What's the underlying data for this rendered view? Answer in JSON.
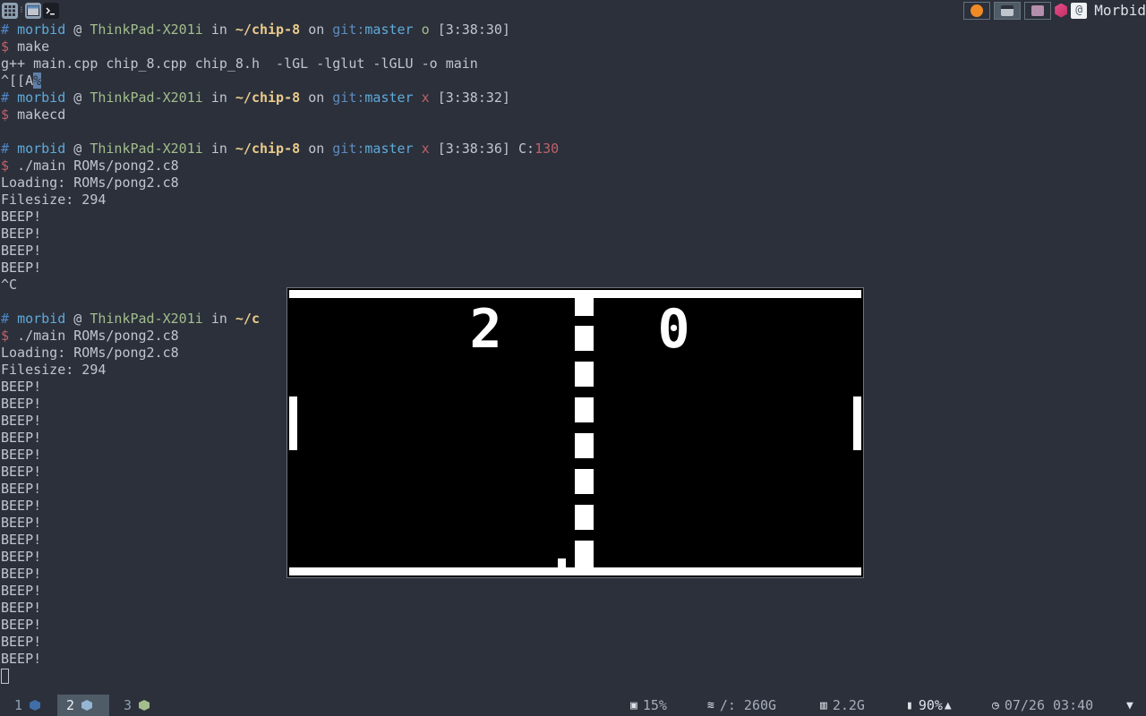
{
  "colors": {
    "background": "#2b303b",
    "text": "#c0c5ce",
    "prompt_hash": "#4f87c9",
    "username": "#5faad9",
    "hostname": "#a3be8c",
    "path": "#ebcb8b",
    "git_dirty": "#bf616a",
    "error_code": "#bf616a",
    "accent_active": "#4f5b66",
    "ws1_hex": "#3f6ea8",
    "ws2_hex": "#96b5d4",
    "ws3_hex": "#a3be8c"
  },
  "topbar": {
    "left_icons": [
      "apps-grid-icon",
      "window-icon",
      "terminal-icon"
    ],
    "tray_icons": [
      "firefox-icon",
      "screen-icon",
      "folder-icon"
    ],
    "user": "Morbid"
  },
  "terminal": {
    "prompt1": {
      "hash": "#",
      "user": "morbid",
      "at": "@",
      "host": "ThinkPad-X201i",
      "in": "in",
      "path": "~/chip-8",
      "on": "on",
      "git": "git:",
      "branch": "master",
      "status": "o",
      "time": "[3:38:30]"
    },
    "cmd1": "make",
    "out1": "g++ main.cpp chip_8.cpp chip_8.h  -lGL -lglut -lGLU -o main",
    "out2_pre": "^[[A",
    "out2_hl": "%",
    "prompt2": {
      "status": "x",
      "time": "[3:38:32]"
    },
    "cmd2": "makecd",
    "prompt3": {
      "status": "x",
      "time": "[3:38:36]",
      "code_label": "C:",
      "code": "130"
    },
    "cmd3": "./main ROMs/pong2.c8",
    "load1": "Loading: ROMs/pong2.c8",
    "size1": "Filesize: 294",
    "beep": "BEEP!",
    "ctrl_c": "^C",
    "prompt4_visible": "# morbid @ ThinkPad-X201i in ~/c",
    "prompt4": {
      "hash": "#",
      "user": "morbid",
      "at": "@",
      "host": "ThinkPad-X201i",
      "in": "in",
      "path": "~/c"
    },
    "cmd4": "./main ROMs/pong2.c8",
    "load2": "Loading: ROMs/pong2.c8",
    "size2": "Filesize: 294",
    "dollar": "$"
  },
  "game": {
    "score_left": "2",
    "score_right": "0"
  },
  "bottombar": {
    "workspaces": [
      {
        "num": "1",
        "active": false
      },
      {
        "num": "2",
        "active": true
      },
      {
        "num": "3",
        "active": false
      }
    ],
    "cpu": "15%",
    "disk": "/: 260G",
    "mem": "2.2G",
    "battery": "90%",
    "datetime": "07/26 03:40"
  }
}
